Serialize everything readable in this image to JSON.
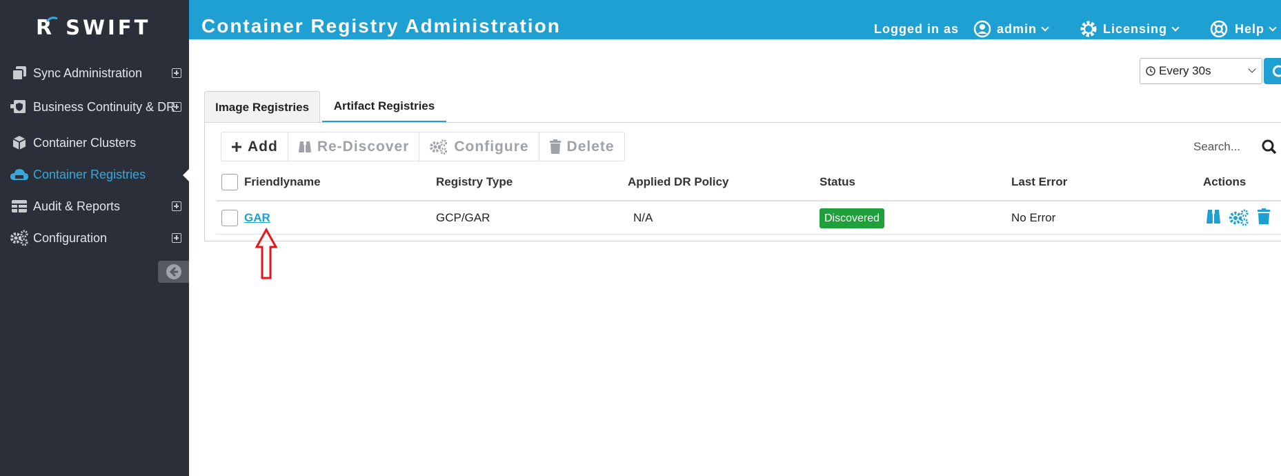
{
  "brand": {
    "logo_text": "SWIFT",
    "logo_letter": "R"
  },
  "sidebar": {
    "items": [
      {
        "label": "Sync Administration",
        "icon": "copy-icon",
        "expandable": true
      },
      {
        "label": "Business Continuity & DR",
        "icon": "shield-icon",
        "expandable": true
      },
      {
        "label": "Container Clusters",
        "icon": "cube-icon",
        "expandable": false
      },
      {
        "label": "Container Registries",
        "icon": "cloud-icon",
        "expandable": false,
        "active": true
      },
      {
        "label": "Audit & Reports",
        "icon": "table-icon",
        "expandable": true
      },
      {
        "label": "Configuration",
        "icon": "gears-icon",
        "expandable": true
      }
    ],
    "collapse_icon": "arrow-left-circle-icon"
  },
  "header": {
    "title": "Container Registry Administration",
    "logged_in_label": "Logged in as",
    "user": "admin",
    "licensing": "Licensing",
    "help": "Help"
  },
  "refresh": {
    "selected": "Every 30s"
  },
  "tabs": [
    {
      "label": "Image Registries",
      "active": false
    },
    {
      "label": "Artifact Registries",
      "active": true
    }
  ],
  "toolbar": {
    "add": "Add",
    "rediscover": "Re-Discover",
    "configure": "Configure",
    "delete": "Delete"
  },
  "search": {
    "placeholder": "Search..."
  },
  "table": {
    "columns": [
      "Friendlyname",
      "Registry Type",
      "Applied DR Policy",
      "Status",
      "Last Error",
      "Actions"
    ],
    "rows": [
      {
        "friendlyname": "GAR",
        "registry_type": "GCP/GAR",
        "dr_policy": "N/A",
        "status": "Discovered",
        "last_error": "No Error"
      }
    ]
  },
  "colors": {
    "accent": "#1ea0d2",
    "sidebar_bg": "#2b2f3a",
    "status_green": "#1fa03a",
    "annotation_red": "#e8141b"
  }
}
